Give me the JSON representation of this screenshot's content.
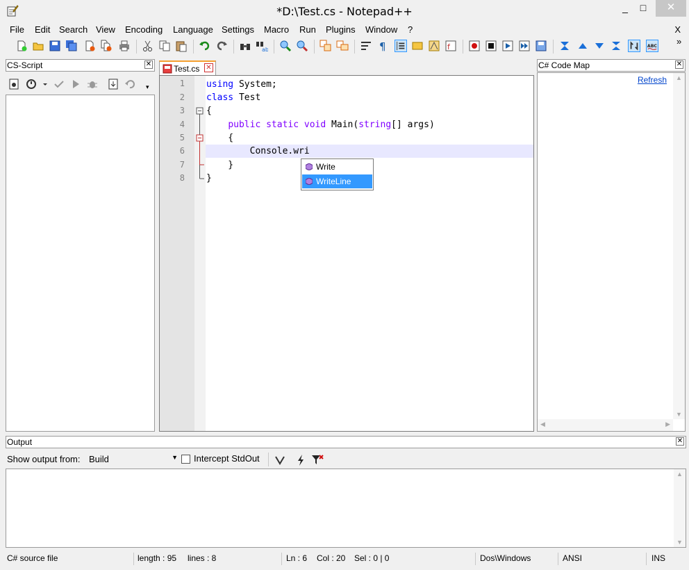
{
  "window": {
    "title": "*D:\\Test.cs - Notepad++",
    "minimize": "_",
    "maximize": "□",
    "close": "✕"
  },
  "menu": {
    "items": [
      "File",
      "Edit",
      "Search",
      "View",
      "Encoding",
      "Language",
      "Settings",
      "Macro",
      "Run",
      "Plugins",
      "Window",
      "?"
    ],
    "close": "X"
  },
  "toolbar": {
    "overflow": "»",
    "icons": [
      "new-file-icon",
      "open-file-icon",
      "save-icon",
      "save-all-icon",
      "close-icon",
      "close-all-icon",
      "print-icon",
      "cut-icon",
      "copy-icon",
      "paste-icon",
      "undo-icon",
      "redo-icon",
      "find-icon",
      "replace-icon",
      "zoom-in-icon",
      "zoom-out-icon",
      "sync-vertical-icon",
      "sync-horizontal-icon",
      "word-wrap-icon",
      "show-all-chars-icon",
      "indent-guide-icon",
      "user-lang-icon",
      "doc-map-icon",
      "function-list-icon",
      "record-macro-icon",
      "stop-macro-icon",
      "play-macro-icon",
      "run-macro-multiple-icon",
      "save-macro-icon",
      "fold-all-icon",
      "prev-icon",
      "next-icon",
      "unfold-all-icon",
      "sync-icon",
      "spellcheck-icon"
    ]
  },
  "cs_script": {
    "title": "CS-Script",
    "close": "✕",
    "tools": [
      "load-script-icon",
      "run-icon",
      "check-icon",
      "play-icon",
      "debug-icon",
      "sync-icon",
      "undo-icon"
    ]
  },
  "editor": {
    "tab_label": "Test.cs",
    "tab_close": "✕",
    "lines": [
      {
        "n": "1",
        "text": "using System;"
      },
      {
        "n": "2",
        "text": "class Test"
      },
      {
        "n": "3",
        "text": "{"
      },
      {
        "n": "4",
        "text": "    public static void Main(string[] args)"
      },
      {
        "n": "5",
        "text": "    {"
      },
      {
        "n": "6",
        "text": "        Console.wri"
      },
      {
        "n": "7",
        "text": "    }"
      },
      {
        "n": "8",
        "text": "}"
      }
    ]
  },
  "autocomplete": {
    "items": [
      {
        "label": "Write",
        "selected": false
      },
      {
        "label": "WriteLine",
        "selected": true
      }
    ]
  },
  "code_map": {
    "title": "C# Code Map",
    "close": "✕",
    "refresh": "Refresh"
  },
  "output": {
    "title": "Output",
    "close": "✕",
    "show_from_label": "Show output from:",
    "show_from_value": "Build",
    "intercept_label": "Intercept StdOut"
  },
  "status": {
    "file_type": "C# source file",
    "length": "length : 95",
    "lines": "lines : 8",
    "ln": "Ln : 6",
    "col": "Col : 20",
    "sel": "Sel : 0 | 0",
    "eol": "Dos\\Windows",
    "encoding": "ANSI",
    "mode": "INS"
  },
  "colors": {
    "keyword": "#0000ff",
    "type_keyword": "#8000ff",
    "selection": "#3399ff",
    "current_line": "#e8e8ff"
  }
}
